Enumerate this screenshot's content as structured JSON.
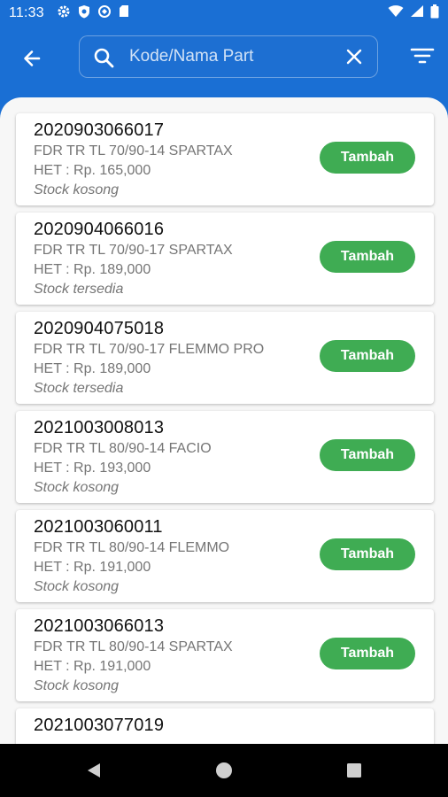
{
  "status_bar": {
    "time": "11:33"
  },
  "search": {
    "placeholder": "Kode/Nama Part",
    "value": ""
  },
  "icons": {
    "back": "arrow-left-icon",
    "search": "search-icon",
    "clear": "close-icon",
    "filter": "filter-icon"
  },
  "colors": {
    "primary": "#1a6fd4",
    "button": "#3fac53",
    "background": "#f7f7f7"
  },
  "items": [
    {
      "code": "2020903066017",
      "name": "FDR TR TL 70/90-14 SPARTAX",
      "price": "HET : Rp. 165,000",
      "stock": "Stock kosong",
      "button": "Tambah"
    },
    {
      "code": "2020904066016",
      "name": "FDR TR TL 70/90-17 SPARTAX",
      "price": "HET : Rp. 189,000",
      "stock": "Stock tersedia",
      "button": "Tambah"
    },
    {
      "code": "2020904075018",
      "name": "FDR TR TL 70/90-17 FLEMMO PRO",
      "price": "HET : Rp. 189,000",
      "stock": "Stock tersedia",
      "button": "Tambah"
    },
    {
      "code": "2021003008013",
      "name": "FDR TR TL 80/90-14 FACIO",
      "price": "HET : Rp. 193,000",
      "stock": "Stock kosong",
      "button": "Tambah"
    },
    {
      "code": "2021003060011",
      "name": "FDR TR TL 80/90-14 FLEMMO",
      "price": "HET : Rp. 191,000",
      "stock": "Stock kosong",
      "button": "Tambah"
    },
    {
      "code": "2021003066013",
      "name": "FDR TR TL 80/90-14 SPARTAX",
      "price": "HET : Rp. 191,000",
      "stock": "Stock kosong",
      "button": "Tambah"
    },
    {
      "code": "2021003077019"
    }
  ]
}
